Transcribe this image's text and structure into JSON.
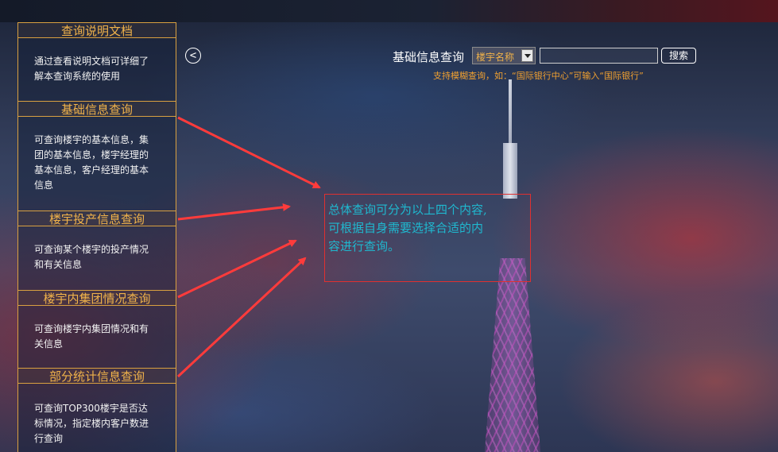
{
  "sidebar": {
    "sections": [
      {
        "title": "查询说明文档",
        "lines": [
          "通过查看说明文档可详细了",
          "解本查询系统的使用"
        ]
      },
      {
        "title": "基础信息查询",
        "lines": [
          "可查询楼宇的基本信息，集",
          "团的基本信息，楼宇经理的",
          "基本信息，客户经理的基本",
          "信息"
        ]
      },
      {
        "title": "楼宇投产信息查询",
        "lines": [
          "可查询某个楼宇的投产情况",
          "和有关信息"
        ]
      },
      {
        "title": "楼宇内集团情况查询",
        "lines": [
          "可查询楼宇内集团情况和有",
          "关信息"
        ]
      },
      {
        "title": "部分统计信息查询",
        "lines": [
          "可查询TOP300楼宇是否达",
          "标情况，指定楼内客户数进",
          "行查询"
        ]
      }
    ]
  },
  "collapse_button": {
    "label": "<"
  },
  "search": {
    "label": "基础信息查询",
    "select_value": "楼宇名称",
    "input_value": "",
    "button_label": "搜索",
    "hint": "支持模糊查询，如：“国际银行中心”可输入“国际银行”"
  },
  "annotation": {
    "lines": [
      "总体查询可分为以上四个内容,",
      "可根据自身需要选择合适的内",
      "容进行查询。"
    ]
  },
  "colors": {
    "accent": "#f0b24a",
    "annotation_border": "#e03030",
    "annotation_text": "#1fb8cf",
    "arrow": "#ff3b3b"
  },
  "icons": {
    "collapse": "chevron-left-icon",
    "select_arrow": "chevron-down-icon"
  }
}
